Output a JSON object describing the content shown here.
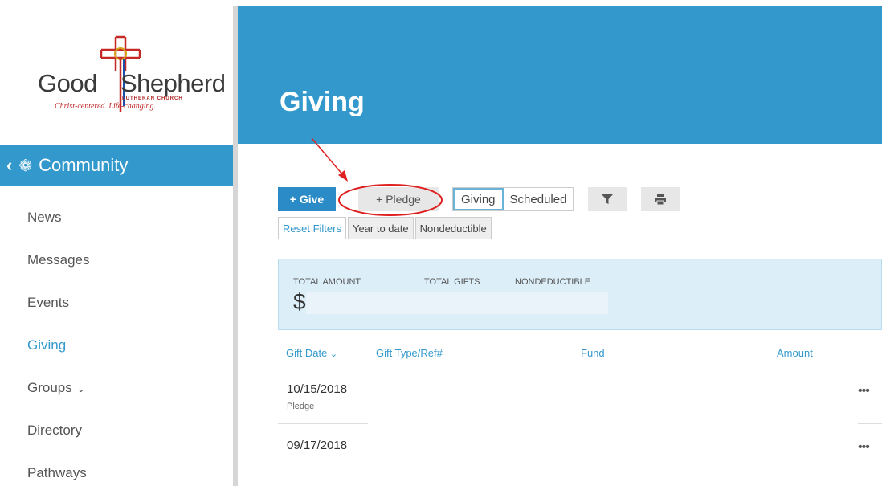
{
  "logo": {
    "word_left": "Good",
    "word_right": "Shepherd",
    "subtitle": "LUTHERAN CHURCH",
    "tagline": "Christ-centered. Life-changing."
  },
  "sidebar": {
    "section": {
      "label": "Community",
      "icon": "community-gear-icon"
    },
    "items": [
      {
        "label": "News"
      },
      {
        "label": "Messages"
      },
      {
        "label": "Events"
      },
      {
        "label": "Giving",
        "active": true
      },
      {
        "label": "Groups",
        "has_dropdown": true
      },
      {
        "label": "Directory"
      },
      {
        "label": "Pathways"
      }
    ]
  },
  "header": {
    "title": "Giving"
  },
  "toolbar": {
    "give_label": "+ Give",
    "pledge_label": "+ Pledge",
    "tabs": [
      {
        "label": "Giving",
        "selected": true
      },
      {
        "label": "Scheduled",
        "selected": false
      }
    ],
    "filter_icon": "filter-icon",
    "print_icon": "print-icon"
  },
  "filters": {
    "reset_label": "Reset Filters",
    "chips": [
      "Year to date",
      "Nondeductible"
    ]
  },
  "summary": {
    "total_amount_label": "TOTAL AMOUNT",
    "total_gifts_label": "TOTAL GIFTS",
    "nondeductible_label": "NONDEDUCTIBLE",
    "currency_symbol": "$"
  },
  "table": {
    "columns": [
      "Gift Date",
      "Gift Type/Ref#",
      "Fund",
      "Amount"
    ],
    "rows": [
      {
        "date": "10/15/2018",
        "type": "Pledge"
      },
      {
        "date": "09/17/2018",
        "type": ""
      }
    ],
    "row_menu": "•••"
  },
  "colors": {
    "accent": "#3399cc",
    "give_button": "#2b8bc6",
    "summary_bg": "#dceef8",
    "annotation": "#e02020"
  }
}
